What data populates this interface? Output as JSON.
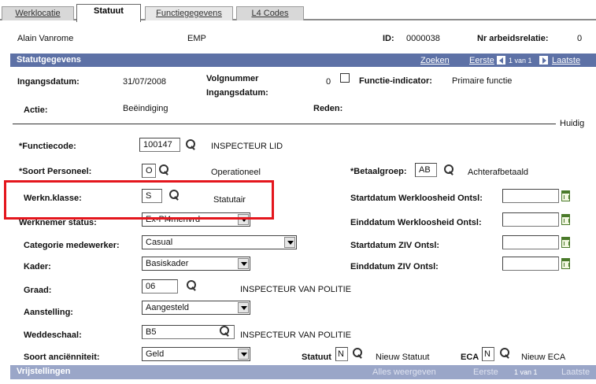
{
  "tabs": [
    {
      "label": "Werklocatie",
      "active": false
    },
    {
      "label": "Statuut",
      "active": true
    },
    {
      "label": "Functiegegevens",
      "active": false
    },
    {
      "label": "L4 Codes",
      "active": false
    }
  ],
  "header": {
    "name": "Alain Vanrome",
    "type": "EMP",
    "id_label": "ID:",
    "id_value": "0000038",
    "rel_label": "Nr arbeidsrelatie:",
    "rel_value": "0"
  },
  "section": {
    "title": "Statutgegevens",
    "search_link": "Zoeken",
    "first_link": "Eerste",
    "range_text": "1 van 1",
    "last_link": "Laatste"
  },
  "effective": {
    "date_label": "Ingangsdatum:",
    "date_value": "31/07/2008",
    "seq_label_1": "Volgnummer",
    "seq_label_2": "Ingangsdatum:",
    "seq_value": "0",
    "func_label": "Functie-indicator:",
    "func_value": "Primaire functie",
    "action_label": "Actie:",
    "action_value": "Beëindiging",
    "reason_label": "Reden:",
    "current_label": "Huidig"
  },
  "fields": {
    "function_code": {
      "label": "*Functiecode:",
      "value": "100147",
      "desc": "INSPECTEUR LID"
    },
    "personnel_type": {
      "label": "*Soort Personeel:",
      "value": "O",
      "desc": "Operationeel"
    },
    "pay_group": {
      "label": "*Betaalgroep:",
      "value": "AB",
      "desc": "Achterafbetaald"
    },
    "work_class": {
      "label": "Werkn.klasse:",
      "value": "S",
      "desc": "Statutair"
    },
    "employee_status": {
      "label": "Werknemer status:",
      "value": "Ex-Pl4menvrd"
    },
    "category": {
      "label": "Categorie medewerker:",
      "value": "Casual"
    },
    "frame": {
      "label": "Kader:",
      "value": "Basiskader"
    },
    "grade": {
      "label": "Graad:",
      "value": "06",
      "desc": "INSPECTEUR  VAN POLITIE"
    },
    "appointment": {
      "label": "Aanstelling:",
      "value": "Aangesteld"
    },
    "salary_scale": {
      "label": "Weddeschaal:",
      "value": "B5",
      "desc": "INSPECTEUR VAN POLITIE"
    },
    "seniority": {
      "label": "Soort anciënniteit:",
      "value": "Geld"
    },
    "statute": {
      "label": "Statuut",
      "value": "N",
      "desc": "Nieuw Statuut"
    },
    "eca": {
      "label": "ECA",
      "value": "N",
      "desc": "Nieuw ECA"
    },
    "unemp_start": {
      "label": "Startdatum Werkloosheid Ontsl:"
    },
    "unemp_end": {
      "label": "Einddatum Werkloosheid Ontsl:"
    },
    "ziv_start": {
      "label": "Startdatum ZIV Ontsl:"
    },
    "ziv_end": {
      "label": "Einddatum ZIV Ontsl:"
    }
  },
  "bottom": {
    "title": "Vrijstellingen",
    "show_all": "Alles weergeven",
    "first": "Eerste",
    "range": "1 van 1",
    "last": "Laatste"
  },
  "colors": {
    "section_bar": "#5d71a6",
    "highlight": "#e4161d"
  }
}
